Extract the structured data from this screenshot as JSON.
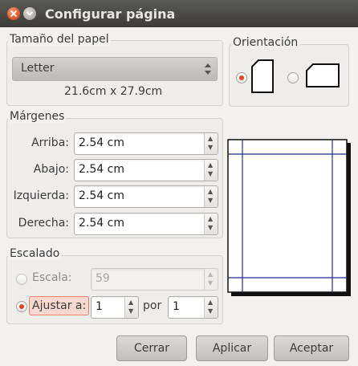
{
  "window": {
    "title": "Configurar página"
  },
  "paper_size": {
    "label": "Tamaño del papel",
    "selected": "Letter",
    "dimensions": "21.6cm x 27.9cm"
  },
  "orientation": {
    "label": "Orientación",
    "selected": "portrait"
  },
  "margins": {
    "label": "Márgenes",
    "top_label": "Arriba:",
    "top_value": "2.54 cm",
    "bottom_label": "Abajo:",
    "bottom_value": "2.54 cm",
    "left_label": "Izquierda:",
    "left_value": "2.54 cm",
    "right_label": "Derecha:",
    "right_value": "2.54 cm"
  },
  "scaling": {
    "label": "Escalado",
    "scale_label": "Escala:",
    "scale_value": "59",
    "fit_label": "Ajustar a:",
    "fit_value_a": "1",
    "por_label": "por",
    "fit_value_b": "1",
    "selected": "fit"
  },
  "buttons": {
    "close": "Cerrar",
    "apply": "Aplicar",
    "accept": "Aceptar"
  },
  "colors": {
    "accent": "#e0481c",
    "margin_lines": "#1f2b8f"
  }
}
